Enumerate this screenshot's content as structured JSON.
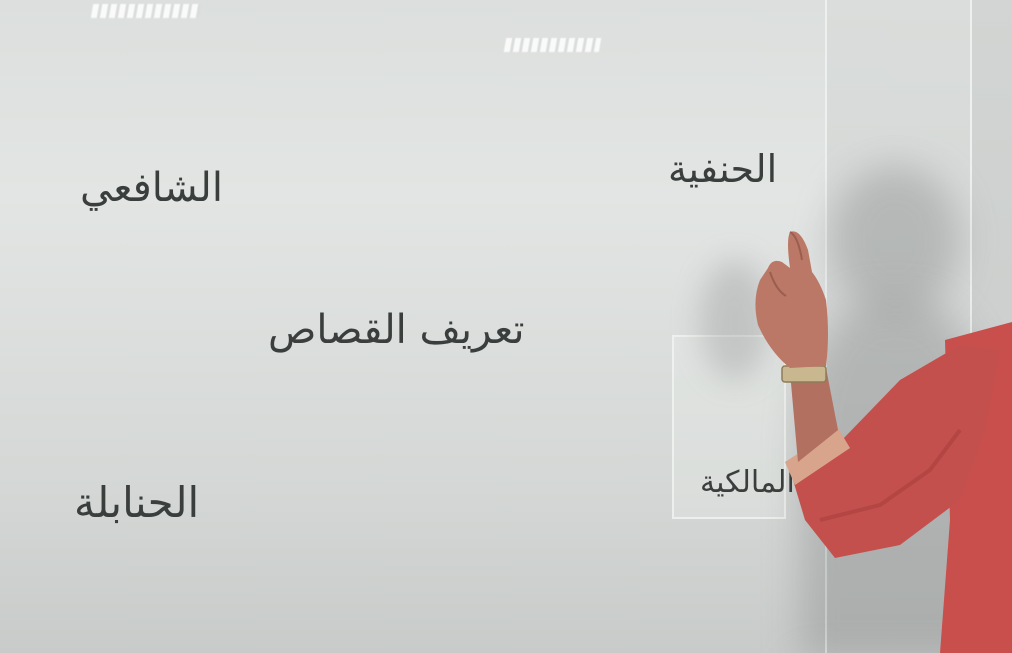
{
  "board": {
    "top_left": "الشافعي",
    "top_right": "الحنفية",
    "center": "تعريف القصاص",
    "bottom_left": "الحنابلة",
    "bottom_right": "المالكية"
  },
  "colors": {
    "board": "#dcdfdd",
    "ink": "#3a3f3d",
    "sleeve": "#c84f4c",
    "skin": "#b67462",
    "watch": "#c8b68d"
  }
}
